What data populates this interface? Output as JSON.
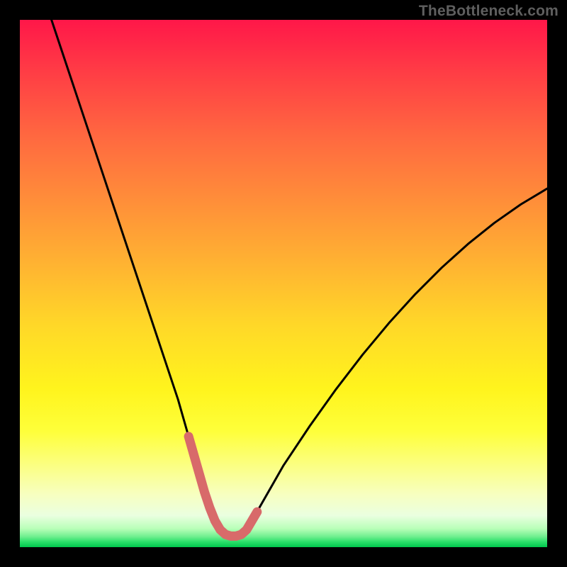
{
  "watermark": "TheBottleneck.com",
  "colors": {
    "page_bg": "#000000",
    "gradient_top": "#ff1749",
    "gradient_bottom": "#00c74d",
    "curve_stroke": "#000000",
    "highlight_stroke": "#d86a6a"
  },
  "chart_data": {
    "type": "line",
    "title": "",
    "xlabel": "",
    "ylabel": "",
    "xlim": [
      0,
      100
    ],
    "ylim": [
      0,
      100
    ],
    "series": [
      {
        "name": "bottleneck-curve",
        "x": [
          6,
          8,
          10,
          12,
          14,
          16,
          18,
          20,
          22,
          24,
          26,
          28,
          30,
          32,
          33,
          34,
          35,
          36,
          37,
          38,
          39,
          40,
          41,
          42,
          43,
          44,
          46,
          48,
          50,
          55,
          60,
          65,
          70,
          75,
          80,
          85,
          90,
          95,
          100
        ],
        "y": [
          100,
          94,
          88,
          82,
          76,
          70,
          64,
          58,
          52,
          46,
          40,
          34,
          28,
          21,
          17.5,
          14,
          10.5,
          7.5,
          5,
          3.3,
          2.4,
          2.1,
          2.1,
          2.4,
          3.3,
          5,
          8.5,
          12,
          15.5,
          23,
          30,
          36.5,
          42.5,
          48,
          53,
          57.5,
          61.5,
          65,
          68
        ]
      }
    ],
    "highlight": {
      "name": "optimal-zone",
      "x": [
        32,
        33,
        34,
        35,
        36,
        37,
        38,
        39,
        40,
        41,
        42,
        43,
        44,
        45
      ],
      "y": [
        21,
        17.5,
        14,
        10.5,
        7.5,
        5,
        3.3,
        2.4,
        2.1,
        2.1,
        2.4,
        3.3,
        5,
        6.7
      ]
    }
  }
}
